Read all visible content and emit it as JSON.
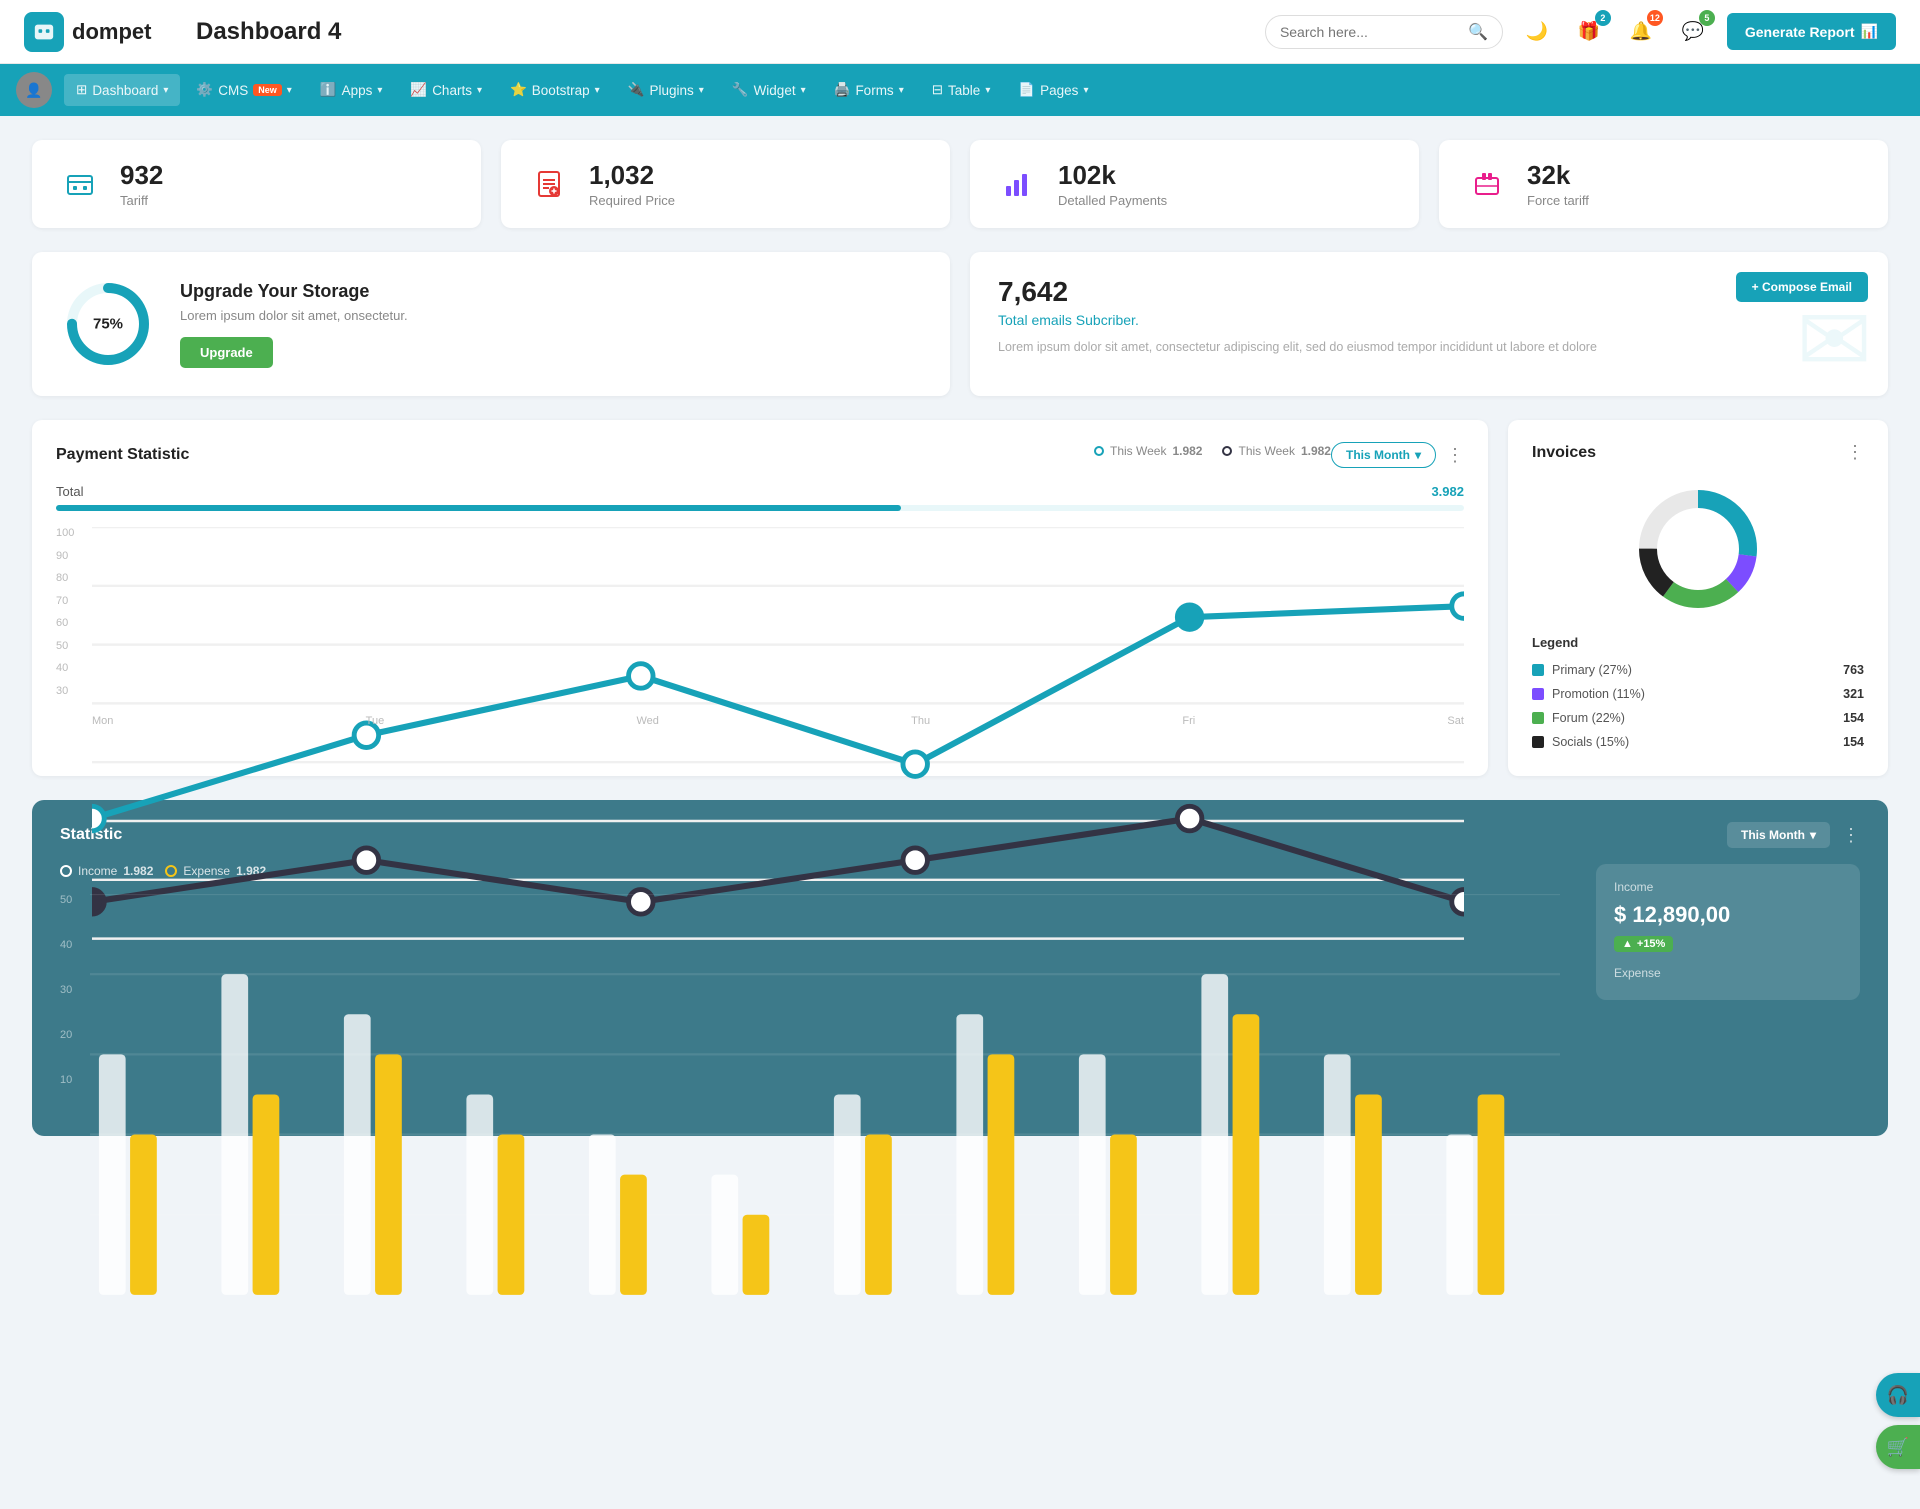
{
  "header": {
    "logo_icon": "💼",
    "logo_text": "dompet",
    "page_title": "Dashboard 4",
    "search_placeholder": "Search here...",
    "generate_btn": "Generate Report"
  },
  "header_icons": {
    "moon": "🌙",
    "gift": "🎁",
    "bell": "🔔",
    "chat": "💬"
  },
  "badges": {
    "gift": "2",
    "bell": "12",
    "chat": "5"
  },
  "nav": {
    "items": [
      {
        "label": "Dashboard",
        "active": true,
        "has_arrow": true
      },
      {
        "label": "CMS",
        "active": false,
        "has_arrow": true,
        "is_new": true
      },
      {
        "label": "Apps",
        "active": false,
        "has_arrow": true
      },
      {
        "label": "Charts",
        "active": false,
        "has_arrow": true
      },
      {
        "label": "Bootstrap",
        "active": false,
        "has_arrow": true
      },
      {
        "label": "Plugins",
        "active": false,
        "has_arrow": true
      },
      {
        "label": "Widget",
        "active": false,
        "has_arrow": true
      },
      {
        "label": "Forms",
        "active": false,
        "has_arrow": true
      },
      {
        "label": "Table",
        "active": false,
        "has_arrow": true
      },
      {
        "label": "Pages",
        "active": false,
        "has_arrow": true
      }
    ]
  },
  "stat_cards": [
    {
      "value": "932",
      "label": "Tariff",
      "icon": "🏢",
      "color": "teal"
    },
    {
      "value": "1,032",
      "label": "Required Price",
      "icon": "📋",
      "color": "red"
    },
    {
      "value": "102k",
      "label": "Detalled Payments",
      "icon": "📊",
      "color": "purple"
    },
    {
      "value": "32k",
      "label": "Force tariff",
      "icon": "🏗️",
      "color": "pink"
    }
  ],
  "storage": {
    "percent": "75%",
    "title": "Upgrade Your Storage",
    "desc": "Lorem ipsum dolor sit amet, onsectetur.",
    "btn": "Upgrade"
  },
  "email": {
    "number": "7,642",
    "subtitle": "Total emails Subcriber.",
    "desc": "Lorem ipsum dolor sit amet, consectetur adipiscing elit, sed do eiusmod tempor incididunt ut labore et dolore",
    "compose_btn": "+ Compose Email"
  },
  "payment": {
    "title": "Payment Statistic",
    "this_month": "This Month",
    "legend": [
      {
        "label": "This Week",
        "value": "1.982",
        "color": "teal"
      },
      {
        "label": "This Week",
        "value": "1.982",
        "color": "dark"
      }
    ],
    "total_label": "Total",
    "total_value": "3.982",
    "progress": 60,
    "x_labels": [
      "Mon",
      "Tue",
      "Wed",
      "Thu",
      "Fri",
      "Sat"
    ],
    "y_labels": [
      "100",
      "90",
      "80",
      "70",
      "60",
      "50",
      "40",
      "30"
    ]
  },
  "invoices": {
    "title": "Invoices",
    "legend_title": "Legend",
    "segments": [
      {
        "label": "Primary (27%)",
        "color": "#17a2b8",
        "value": "763"
      },
      {
        "label": "Promotion (11%)",
        "color": "#7c4dff",
        "value": "321"
      },
      {
        "label": "Forum (22%)",
        "color": "#4caf50",
        "value": "154"
      },
      {
        "label": "Socials (15%)",
        "color": "#222",
        "value": "154"
      }
    ]
  },
  "statistic": {
    "title": "Statistic",
    "this_month": "This Month",
    "income_label": "Income",
    "income_value": "1.982",
    "expense_label": "Expense",
    "expense_value": "1.982",
    "y_labels": [
      "50",
      "40",
      "30",
      "20",
      "10"
    ],
    "income_section": {
      "label": "Income",
      "value": "$ 12,890,00",
      "change": "+15%"
    },
    "expense_section": {
      "label": "Expense"
    }
  },
  "float_btns": [
    {
      "icon": "🎧",
      "color": "teal"
    },
    {
      "icon": "🛒",
      "color": "green"
    }
  ]
}
